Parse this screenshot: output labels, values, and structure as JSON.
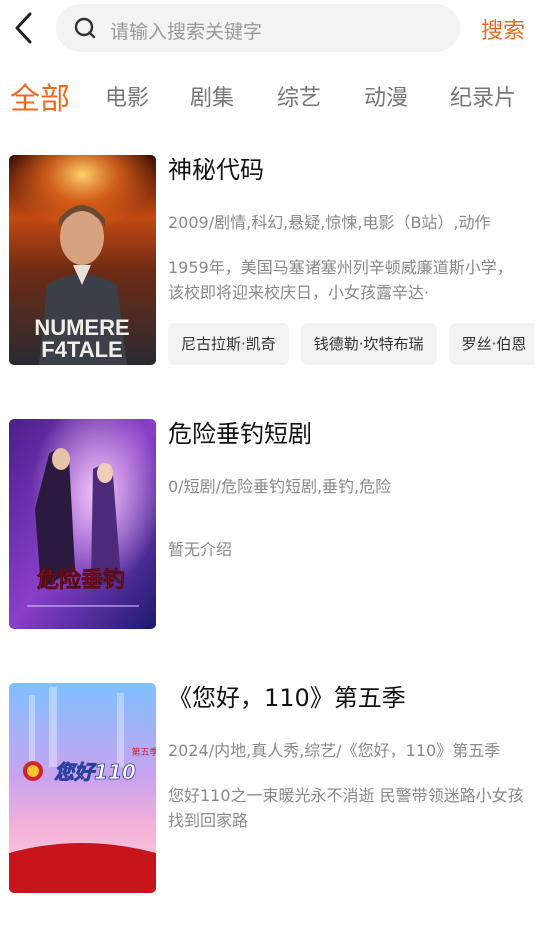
{
  "search": {
    "placeholder": "请输入搜索关键字",
    "button_label": "搜索"
  },
  "tabs": [
    {
      "label": "全部",
      "active": true
    },
    {
      "label": "电影",
      "active": false
    },
    {
      "label": "剧集",
      "active": false
    },
    {
      "label": "综艺",
      "active": false
    },
    {
      "label": "动漫",
      "active": false
    },
    {
      "label": "纪录片",
      "active": false
    }
  ],
  "accent_color": "#ef6a1e",
  "results": [
    {
      "title": "神秘代码",
      "meta": "2009/剧情,科幻,悬疑,惊悚,电影（B站）,动作",
      "description": "1959年，美国马塞诸塞州列辛顿威廉道斯小学，该校即将迎来校庆日，小女孩露辛达·",
      "poster_text_1": "NUMERE",
      "poster_text_2": "F4TALE",
      "actors": [
        "尼古拉斯·凯奇",
        "钱德勒·坎特布瑞",
        "罗丝·伯恩"
      ]
    },
    {
      "title": "危险垂钓短剧",
      "meta": "0/短剧/危险垂钓短剧,垂钓,危险",
      "description": "暂无介绍",
      "poster_text_1": "危险垂钓"
    },
    {
      "title": "《您好，110》第五季",
      "meta": "2024/内地,真人秀,综艺/《您好，110》第五季",
      "description": "您好110之一束暖光永不消逝 民警带领迷路小女孩找到回家路",
      "poster_text_1": "您好110",
      "poster_text_2": "第五季"
    }
  ]
}
